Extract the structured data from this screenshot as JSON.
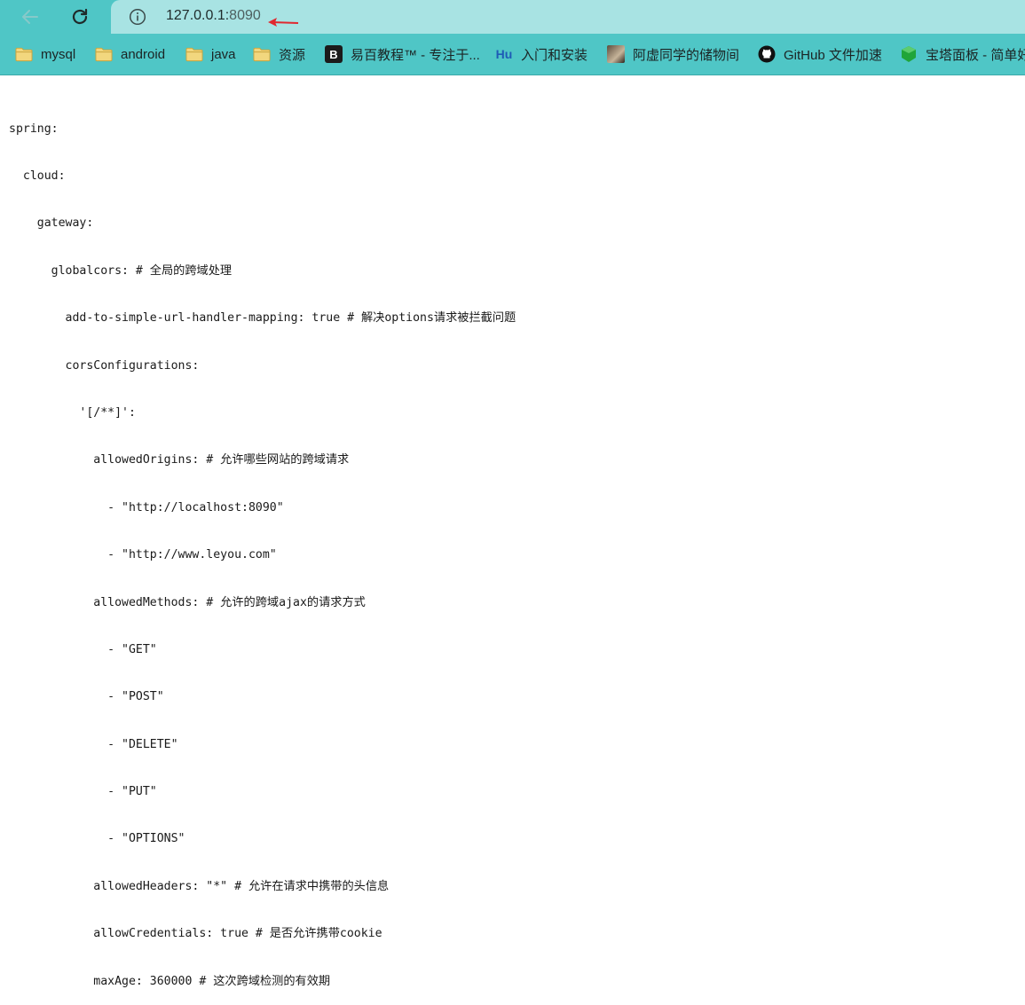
{
  "browser": {
    "url_host": "127.0.0.1:",
    "url_port": "8090",
    "icons": {
      "back": "arrow-left-icon",
      "reload": "reload-icon",
      "info": "info-icon"
    },
    "bookmarks": [
      {
        "label": "mysql",
        "icon": "folder-icon"
      },
      {
        "label": "android",
        "icon": "folder-icon"
      },
      {
        "label": "java",
        "icon": "folder-icon"
      },
      {
        "label": "资源",
        "icon": "folder-icon"
      },
      {
        "label": "易百教程™ - 专注于...",
        "icon": "b-logo-icon",
        "icon_text": "B"
      },
      {
        "label": "入门和安装",
        "icon": "hu-logo-icon",
        "icon_text": "Hu"
      },
      {
        "label": "阿虚同学的储物间",
        "icon": "avatar-icon"
      },
      {
        "label": "GitHub 文件加速",
        "icon": "github-icon"
      },
      {
        "label": "宝塔面板 - 简单好",
        "icon": "bt-panel-icon"
      }
    ]
  },
  "content": {
    "lines": [
      "spring:",
      "  cloud:",
      "    gateway:",
      "      globalcors: # 全局的跨域处理",
      "        add-to-simple-url-handler-mapping: true # 解决options请求被拦截问题",
      "        corsConfigurations:",
      "          '[/**]':",
      "            allowedOrigins: # 允许哪些网站的跨域请求",
      "              - \"http://localhost:8090\"",
      "              - \"http://www.leyou.com\"",
      "            allowedMethods: # 允许的跨域ajax的请求方式",
      "              - \"GET\"",
      "              - \"POST\"",
      "              - \"DELETE\"",
      "              - \"PUT\"",
      "              - \"OPTIONS\"",
      "            allowedHeaders: \"*\" # 允许在请求中携带的头信息",
      "            allowCredentials: true # 是否允许携带cookie",
      "            maxAge: 360000 # 这次跨域检测的有效期"
    ]
  }
}
